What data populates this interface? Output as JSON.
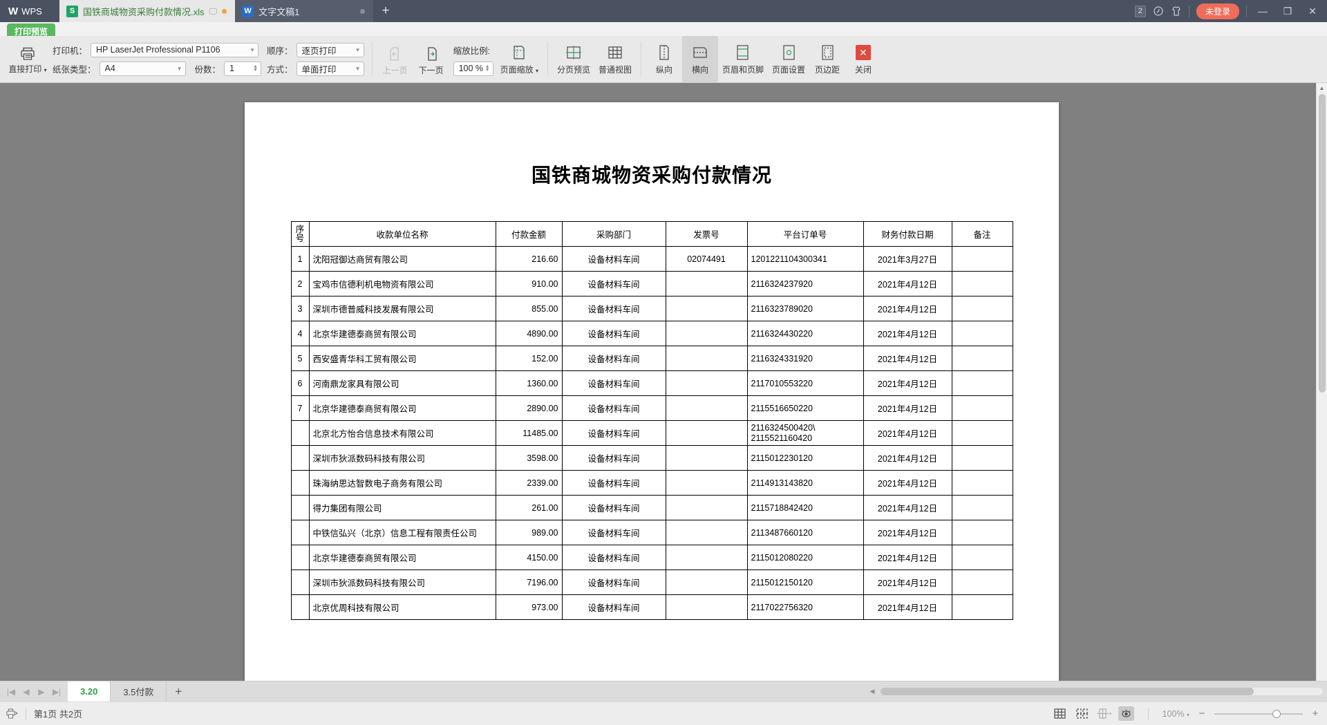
{
  "titlebar": {
    "app_name": "WPS",
    "tabs": [
      {
        "name": "国铁商城物资采购付款情况.xls",
        "type": "xls",
        "active": true
      },
      {
        "name": "文字文稿1",
        "type": "doc",
        "active": false
      }
    ],
    "add_tab": "+",
    "window_count": "2",
    "login_label": "未登录",
    "minimize": "—",
    "restore": "❐",
    "close": "✕"
  },
  "preview_badge": "打印预览",
  "ribbon": {
    "direct_print": "直接打印",
    "printer_label": "打印机：",
    "printer_value": "HP LaserJet Professional P1106",
    "paper_label": "纸张类型：",
    "paper_value": "A4",
    "order_label": "顺序：",
    "order_value": "逐页打印",
    "copies_label": "份数：",
    "copies_value": "1",
    "mode_label": "方式：",
    "mode_value": "单面打印",
    "prev_page": "上一页",
    "next_page": "下一页",
    "zoom_ratio_label": "缩放比例:",
    "zoom_value": "100 %",
    "page_scale": "页面缩放",
    "page_break_preview": "分页预览",
    "normal_view": "普通视图",
    "portrait": "纵向",
    "landscape": "横向",
    "header_footer": "页眉和页脚",
    "page_setup": "页面设置",
    "margins": "页边距",
    "close": "关闭"
  },
  "document": {
    "title": "国铁商城物资采购付款情况",
    "columns": [
      "序号",
      "收款单位名称",
      "付款金额",
      "采购部门",
      "发票号",
      "平台订单号",
      "财务付款日期",
      "备注"
    ],
    "rows": [
      {
        "idx": "1",
        "name": "沈阳冠御达商贸有限公司",
        "amount": "216.60",
        "dept": "设备材料车间",
        "invoice": "02074491",
        "order": "1201221104300341",
        "date": "2021年3月27日",
        "remark": ""
      },
      {
        "idx": "2",
        "name": "宝鸡市信德利机电物资有限公司",
        "amount": "910.00",
        "dept": "设备材料车间",
        "invoice": "",
        "order": "2116324237920",
        "date": "2021年4月12日",
        "remark": ""
      },
      {
        "idx": "3",
        "name": "深圳市德普威科技发展有限公司",
        "amount": "855.00",
        "dept": "设备材料车间",
        "invoice": "",
        "order": "2116323789020",
        "date": "2021年4月12日",
        "remark": ""
      },
      {
        "idx": "4",
        "name": "北京华建德泰商贸有限公司",
        "amount": "4890.00",
        "dept": "设备材料车间",
        "invoice": "",
        "order": "2116324430220",
        "date": "2021年4月12日",
        "remark": ""
      },
      {
        "idx": "5",
        "name": "西安盛青华科工贸有限公司",
        "amount": "152.00",
        "dept": "设备材料车间",
        "invoice": "",
        "order": "2116324331920",
        "date": "2021年4月12日",
        "remark": ""
      },
      {
        "idx": "6",
        "name": "河南鼎龙家具有限公司",
        "amount": "1360.00",
        "dept": "设备材料车间",
        "invoice": "",
        "order": "2117010553220",
        "date": "2021年4月12日",
        "remark": ""
      },
      {
        "idx": "7",
        "name": "北京华建德泰商贸有限公司",
        "amount": "2890.00",
        "dept": "设备材料车间",
        "invoice": "",
        "order": "2115516650220",
        "date": "2021年4月12日",
        "remark": ""
      },
      {
        "idx": "",
        "name": "北京北方怡合信息技术有限公司",
        "amount": "11485.00",
        "dept": "设备材料车间",
        "invoice": "",
        "order": "2116324500420\\\n2115521160420",
        "date": "2021年4月12日",
        "remark": ""
      },
      {
        "idx": "",
        "name": "深圳市狄派数码科技有限公司",
        "amount": "3598.00",
        "dept": "设备材料车间",
        "invoice": "",
        "order": "2115012230120",
        "date": "2021年4月12日",
        "remark": ""
      },
      {
        "idx": "",
        "name": "珠海纳思达智数电子商务有限公司",
        "amount": "2339.00",
        "dept": "设备材料车间",
        "invoice": "",
        "order": "2114913143820",
        "date": "2021年4月12日",
        "remark": ""
      },
      {
        "idx": "",
        "name": "得力集团有限公司",
        "amount": "261.00",
        "dept": "设备材料车间",
        "invoice": "",
        "order": "2115718842420",
        "date": "2021年4月12日",
        "remark": ""
      },
      {
        "idx": "",
        "name": "中铁信弘兴（北京）信息工程有限责任公司",
        "amount": "989.00",
        "dept": "设备材料车间",
        "invoice": "",
        "order": "2113487660120",
        "date": "2021年4月12日",
        "remark": ""
      },
      {
        "idx": "",
        "name": "北京华建德泰商贸有限公司",
        "amount": "4150.00",
        "dept": "设备材料车间",
        "invoice": "",
        "order": "2115012080220",
        "date": "2021年4月12日",
        "remark": ""
      },
      {
        "idx": "",
        "name": "深圳市狄派数码科技有限公司",
        "amount": "7196.00",
        "dept": "设备材料车间",
        "invoice": "",
        "order": "2115012150120",
        "date": "2021年4月12日",
        "remark": ""
      },
      {
        "idx": "",
        "name": "北京优周科技有限公司",
        "amount": "973.00",
        "dept": "设备材料车间",
        "invoice": "",
        "order": "2117022756320",
        "date": "2021年4月12日",
        "remark": ""
      }
    ]
  },
  "sheetbar": {
    "tabs": [
      {
        "label": "3.20",
        "selected": true
      },
      {
        "label": "3.5付款",
        "selected": false
      }
    ],
    "add_sheet": "+"
  },
  "statusbar": {
    "page_info": "第1页 共2页",
    "zoom_label": "100%",
    "zoom_out": "−",
    "zoom_in": "+"
  },
  "colors": {
    "titlebar": "#4a5262",
    "badge_green": "#5ab860",
    "login_red": "#ef6c5a",
    "close_red": "#e04a3f",
    "sheet_active": "#2f9e44"
  }
}
